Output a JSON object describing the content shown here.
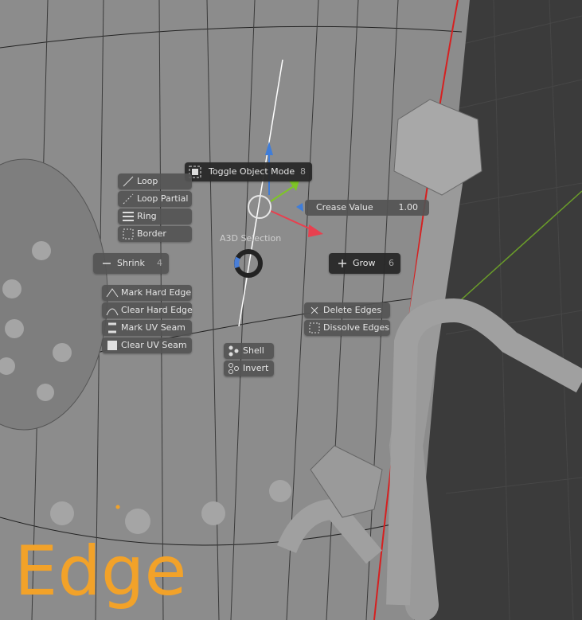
{
  "pie_menu": {
    "title": "A3D Selection",
    "top": {
      "label": "Toggle Object Mode",
      "key": "8",
      "icon": "object-mode-icon"
    },
    "left": {
      "label": "Shrink",
      "key": "4",
      "icon": "minus-icon"
    },
    "right": {
      "label": "Grow",
      "key": "6",
      "icon": "plus-icon"
    },
    "crease": {
      "label": "Crease Value",
      "value": "1.00"
    },
    "select_group": [
      {
        "label": "Loop",
        "icon": "edge-loop-icon"
      },
      {
        "label": "Loop Partial",
        "icon": "loop-partial-icon"
      },
      {
        "label": "Ring",
        "icon": "edge-ring-icon"
      },
      {
        "label": "Border",
        "icon": "border-select-icon"
      }
    ],
    "edge_marks": [
      {
        "label": "Mark Hard Edge",
        "icon": "mark-sharp-icon"
      },
      {
        "label": "Clear Hard Edge",
        "icon": "clear-sharp-icon"
      },
      {
        "label": "Mark UV Seam",
        "icon": "mark-seam-icon"
      },
      {
        "label": "Clear UV Seam",
        "icon": "clear-seam-icon"
      }
    ],
    "edge_ops": [
      {
        "label": "Delete Edges",
        "icon": "x-icon"
      },
      {
        "label": "Dissolve Edges",
        "icon": "dissolve-icon"
      }
    ],
    "bottom": [
      {
        "label": "Shell",
        "icon": "shell-icon"
      },
      {
        "label": "Invert",
        "icon": "invert-icon"
      }
    ]
  },
  "mode_overlay": "Edge",
  "colors": {
    "accent": "#f2a229",
    "x_axis": "#e8404f",
    "y_axis": "#7ec625",
    "z_axis": "#3f7dd9"
  }
}
